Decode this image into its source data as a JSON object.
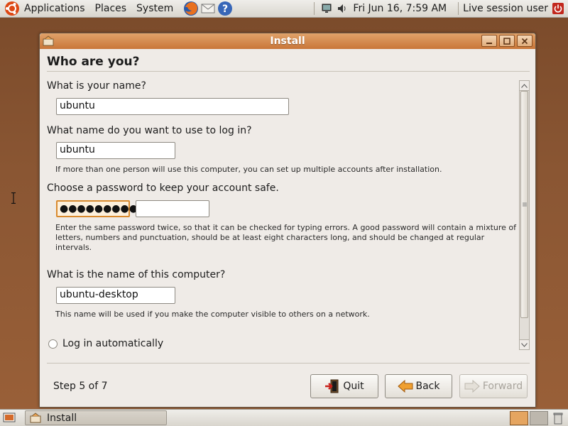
{
  "top_panel": {
    "menus": [
      "Applications",
      "Places",
      "System"
    ],
    "clock": "Fri Jun 16,  7:59 AM",
    "user": "Live session user"
  },
  "window": {
    "title": "Install",
    "heading": "Who are you?",
    "name_question": "What is your name?",
    "name_value": "ubuntu",
    "login_question": "What name do you want to use to log in?",
    "login_value": "ubuntu",
    "login_hint": "If more than one person will use this computer, you can set up multiple accounts after installation.",
    "password_question": "Choose a password to keep your account safe.",
    "password_value": "●●●●●●●●●",
    "password_confirm_value": "",
    "password_hint": "Enter the same password twice, so that it can be checked for typing errors. A good password will contain a mixture of letters, numbers and punctuation, should be at least eight characters long, and should be changed at regular intervals.",
    "computer_question": "What is the name of this computer?",
    "computer_value": "ubuntu-desktop",
    "computer_hint": "This name will be used if you make the computer visible to others on a network.",
    "auto_login_label": "Log in automatically",
    "step_label": "Step 5 of 7",
    "buttons": {
      "quit": "Quit",
      "back": "Back",
      "forward": "Forward"
    }
  },
  "bottom_panel": {
    "task": "Install"
  },
  "colors": {
    "accent_orange": "#d98a2e",
    "titlebar": "#c97638",
    "desktop": "#8a5633"
  }
}
